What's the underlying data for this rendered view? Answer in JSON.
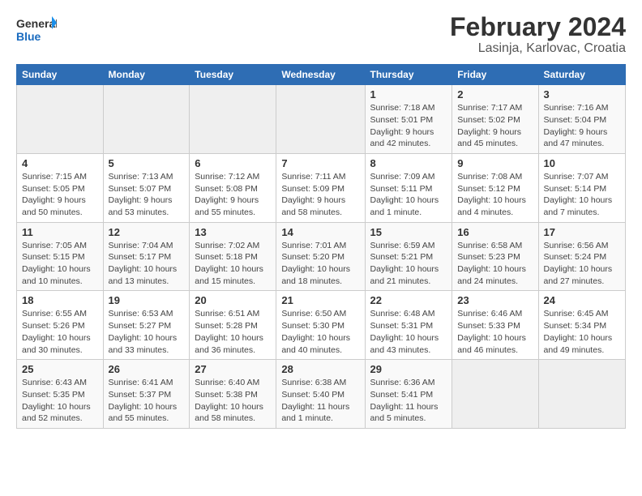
{
  "logo": {
    "line1": "General",
    "line2": "Blue"
  },
  "title": "February 2024",
  "subtitle": "Lasinja, Karlovac, Croatia",
  "days_header": [
    "Sunday",
    "Monday",
    "Tuesday",
    "Wednesday",
    "Thursday",
    "Friday",
    "Saturday"
  ],
  "weeks": [
    [
      {
        "num": "",
        "info": ""
      },
      {
        "num": "",
        "info": ""
      },
      {
        "num": "",
        "info": ""
      },
      {
        "num": "",
        "info": ""
      },
      {
        "num": "1",
        "info": "Sunrise: 7:18 AM\nSunset: 5:01 PM\nDaylight: 9 hours\nand 42 minutes."
      },
      {
        "num": "2",
        "info": "Sunrise: 7:17 AM\nSunset: 5:02 PM\nDaylight: 9 hours\nand 45 minutes."
      },
      {
        "num": "3",
        "info": "Sunrise: 7:16 AM\nSunset: 5:04 PM\nDaylight: 9 hours\nand 47 minutes."
      }
    ],
    [
      {
        "num": "4",
        "info": "Sunrise: 7:15 AM\nSunset: 5:05 PM\nDaylight: 9 hours\nand 50 minutes."
      },
      {
        "num": "5",
        "info": "Sunrise: 7:13 AM\nSunset: 5:07 PM\nDaylight: 9 hours\nand 53 minutes."
      },
      {
        "num": "6",
        "info": "Sunrise: 7:12 AM\nSunset: 5:08 PM\nDaylight: 9 hours\nand 55 minutes."
      },
      {
        "num": "7",
        "info": "Sunrise: 7:11 AM\nSunset: 5:09 PM\nDaylight: 9 hours\nand 58 minutes."
      },
      {
        "num": "8",
        "info": "Sunrise: 7:09 AM\nSunset: 5:11 PM\nDaylight: 10 hours\nand 1 minute."
      },
      {
        "num": "9",
        "info": "Sunrise: 7:08 AM\nSunset: 5:12 PM\nDaylight: 10 hours\nand 4 minutes."
      },
      {
        "num": "10",
        "info": "Sunrise: 7:07 AM\nSunset: 5:14 PM\nDaylight: 10 hours\nand 7 minutes."
      }
    ],
    [
      {
        "num": "11",
        "info": "Sunrise: 7:05 AM\nSunset: 5:15 PM\nDaylight: 10 hours\nand 10 minutes."
      },
      {
        "num": "12",
        "info": "Sunrise: 7:04 AM\nSunset: 5:17 PM\nDaylight: 10 hours\nand 13 minutes."
      },
      {
        "num": "13",
        "info": "Sunrise: 7:02 AM\nSunset: 5:18 PM\nDaylight: 10 hours\nand 15 minutes."
      },
      {
        "num": "14",
        "info": "Sunrise: 7:01 AM\nSunset: 5:20 PM\nDaylight: 10 hours\nand 18 minutes."
      },
      {
        "num": "15",
        "info": "Sunrise: 6:59 AM\nSunset: 5:21 PM\nDaylight: 10 hours\nand 21 minutes."
      },
      {
        "num": "16",
        "info": "Sunrise: 6:58 AM\nSunset: 5:23 PM\nDaylight: 10 hours\nand 24 minutes."
      },
      {
        "num": "17",
        "info": "Sunrise: 6:56 AM\nSunset: 5:24 PM\nDaylight: 10 hours\nand 27 minutes."
      }
    ],
    [
      {
        "num": "18",
        "info": "Sunrise: 6:55 AM\nSunset: 5:26 PM\nDaylight: 10 hours\nand 30 minutes."
      },
      {
        "num": "19",
        "info": "Sunrise: 6:53 AM\nSunset: 5:27 PM\nDaylight: 10 hours\nand 33 minutes."
      },
      {
        "num": "20",
        "info": "Sunrise: 6:51 AM\nSunset: 5:28 PM\nDaylight: 10 hours\nand 36 minutes."
      },
      {
        "num": "21",
        "info": "Sunrise: 6:50 AM\nSunset: 5:30 PM\nDaylight: 10 hours\nand 40 minutes."
      },
      {
        "num": "22",
        "info": "Sunrise: 6:48 AM\nSunset: 5:31 PM\nDaylight: 10 hours\nand 43 minutes."
      },
      {
        "num": "23",
        "info": "Sunrise: 6:46 AM\nSunset: 5:33 PM\nDaylight: 10 hours\nand 46 minutes."
      },
      {
        "num": "24",
        "info": "Sunrise: 6:45 AM\nSunset: 5:34 PM\nDaylight: 10 hours\nand 49 minutes."
      }
    ],
    [
      {
        "num": "25",
        "info": "Sunrise: 6:43 AM\nSunset: 5:35 PM\nDaylight: 10 hours\nand 52 minutes."
      },
      {
        "num": "26",
        "info": "Sunrise: 6:41 AM\nSunset: 5:37 PM\nDaylight: 10 hours\nand 55 minutes."
      },
      {
        "num": "27",
        "info": "Sunrise: 6:40 AM\nSunset: 5:38 PM\nDaylight: 10 hours\nand 58 minutes."
      },
      {
        "num": "28",
        "info": "Sunrise: 6:38 AM\nSunset: 5:40 PM\nDaylight: 11 hours\nand 1 minute."
      },
      {
        "num": "29",
        "info": "Sunrise: 6:36 AM\nSunset: 5:41 PM\nDaylight: 11 hours\nand 5 minutes."
      },
      {
        "num": "",
        "info": ""
      },
      {
        "num": "",
        "info": ""
      }
    ]
  ]
}
